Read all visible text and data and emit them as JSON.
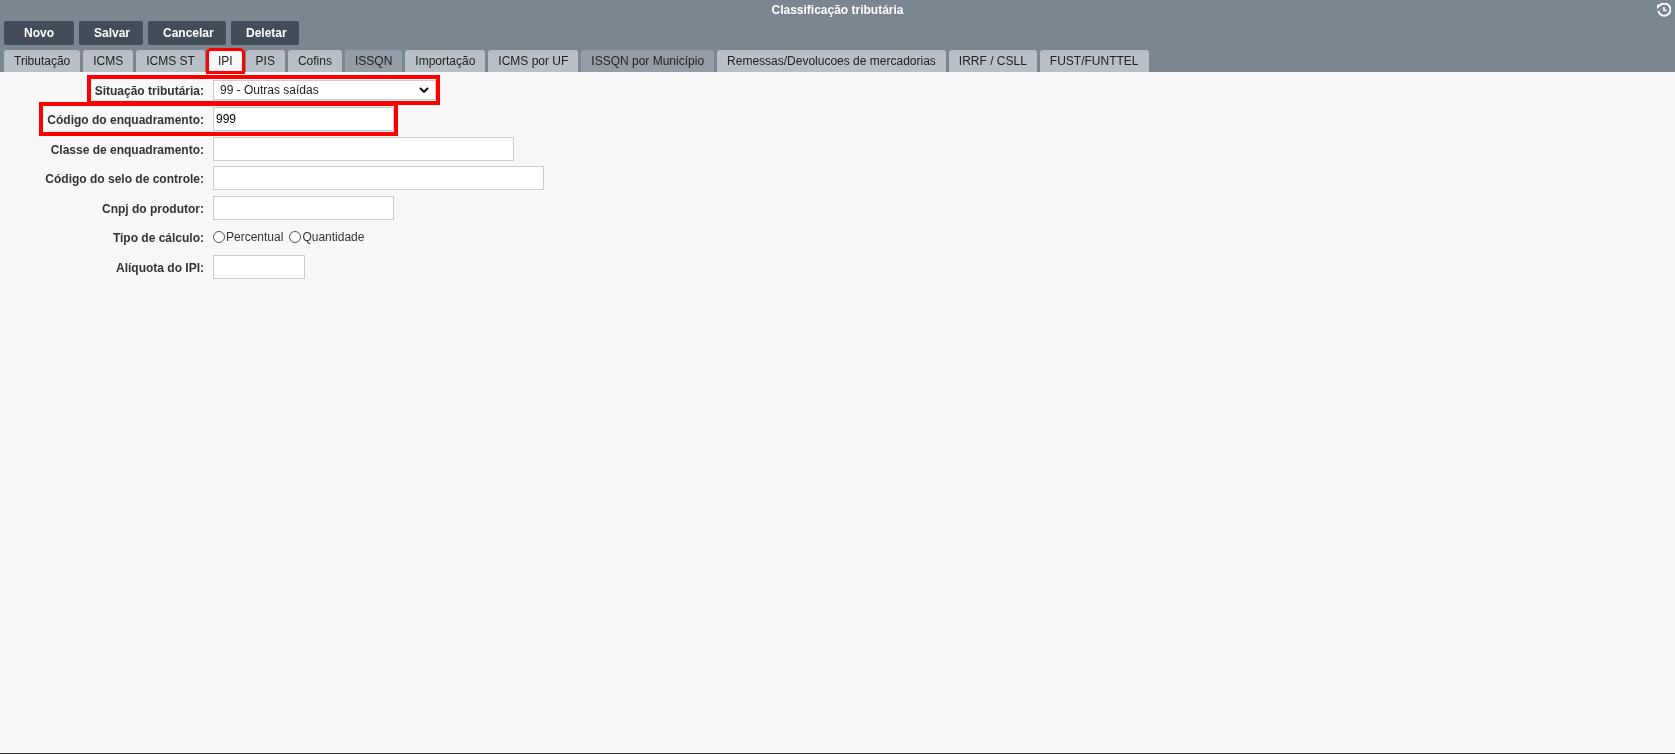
{
  "window": {
    "title": "Classificação tributária"
  },
  "buttons": [
    "Novo",
    "Salvar",
    "Cancelar",
    "Deletar"
  ],
  "tabs": [
    {
      "label": "Tributação",
      "selected": false,
      "disabled": false,
      "highlighted": false
    },
    {
      "label": "ICMS",
      "selected": false,
      "disabled": false,
      "highlighted": false
    },
    {
      "label": "ICMS ST",
      "selected": false,
      "disabled": false,
      "highlighted": false
    },
    {
      "label": "IPI",
      "selected": true,
      "disabled": false,
      "highlighted": true
    },
    {
      "label": "PIS",
      "selected": false,
      "disabled": false,
      "highlighted": false
    },
    {
      "label": "Cofins",
      "selected": false,
      "disabled": false,
      "highlighted": false
    },
    {
      "label": "ISSQN",
      "selected": false,
      "disabled": true,
      "highlighted": false
    },
    {
      "label": "Importação",
      "selected": false,
      "disabled": false,
      "highlighted": false
    },
    {
      "label": "ICMS por UF",
      "selected": false,
      "disabled": false,
      "highlighted": false
    },
    {
      "label": "ISSQN por Município",
      "selected": false,
      "disabled": true,
      "highlighted": false
    },
    {
      "label": "Remessas/Devolucoes de mercadorias",
      "selected": false,
      "disabled": false,
      "highlighted": false
    },
    {
      "label": "IRRF / CSLL",
      "selected": false,
      "disabled": false,
      "highlighted": false
    },
    {
      "label": "FUST/FUNTTEL",
      "selected": false,
      "disabled": false,
      "highlighted": false
    }
  ],
  "fields": [
    {
      "kind": "select",
      "label": "Situação tributária:",
      "value": "99 - Outras saídas",
      "highlighted": true
    },
    {
      "kind": "text",
      "label": "Código do enquadramento:",
      "value": "999",
      "highlighted": true
    },
    {
      "kind": "text",
      "label": "Classe de enquadramento:",
      "highlighted": false
    },
    {
      "kind": "text",
      "label": "Código do selo de controle:",
      "highlighted": false
    },
    {
      "kind": "text",
      "label": "Cnpj do produtor:",
      "highlighted": false
    },
    {
      "kind": "radio",
      "label": "Tipo de cálculo:",
      "highlighted": false,
      "options": [
        {
          "label": "Percentual",
          "selected": false
        },
        {
          "label": "Quantidade",
          "selected": false
        }
      ]
    },
    {
      "kind": "text",
      "label": "Alíquota do IPI:",
      "highlighted": false
    }
  ]
}
